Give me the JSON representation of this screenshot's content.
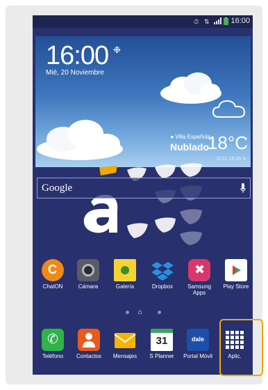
{
  "status_bar": {
    "time": "16:00",
    "icons": [
      "alarm-icon",
      "mobile-data-icon",
      "signal-icon",
      "battery-icon"
    ],
    "accent_color": "#4caf50"
  },
  "weather_widget": {
    "time": "16:00",
    "date": "Mié, 20 Noviembre",
    "location": "Villa Española",
    "condition": "Nublado",
    "temperature": "18°C",
    "updated": "11/11 15:25"
  },
  "search_bar": {
    "label": "Google"
  },
  "apps": [
    {
      "label": "ChatON",
      "icon": "chaton-icon",
      "color": "#f08a17"
    },
    {
      "label": "Cámara",
      "icon": "camera-icon",
      "color": "#5b5b66"
    },
    {
      "label": "Galería",
      "icon": "gallery-icon",
      "color": "#f5d432"
    },
    {
      "label": "Dropbox",
      "icon": "dropbox-icon",
      "color": "#2b8ee0"
    },
    {
      "label": "Samsung Apps",
      "icon": "samsung-apps-icon",
      "color": "#d8376e"
    },
    {
      "label": "Play Store",
      "icon": "play-store-icon",
      "color": "#ffffff"
    }
  ],
  "dock": [
    {
      "label": "Teléfono",
      "icon": "phone-icon",
      "color": "#2fb34a"
    },
    {
      "label": "Contactos",
      "icon": "contacts-icon",
      "color": "#e95a1c"
    },
    {
      "label": "Mensajes",
      "icon": "messages-icon",
      "color": "#f5b400"
    },
    {
      "label": "S Planner",
      "icon": "calendar-icon",
      "color": "#ffffff",
      "day": "31"
    },
    {
      "label": "Portal Móvil",
      "icon": "portal-movil-icon",
      "color": "#1e4fa8",
      "text": "dale"
    },
    {
      "label": "Aplic.",
      "icon": "apps-grid-icon",
      "color": "#ffffff"
    }
  ],
  "highlight_color": "#f2a900"
}
